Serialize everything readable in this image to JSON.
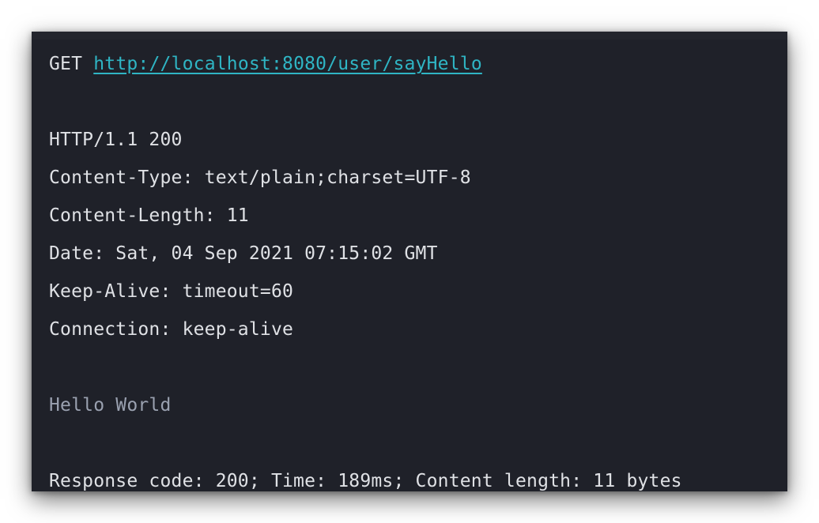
{
  "request": {
    "method": "GET",
    "url": "http://localhost:8080/user/sayHello"
  },
  "response": {
    "status_line": "HTTP/1.1 200",
    "headers": [
      "Content-Type: text/plain;charset=UTF-8",
      "Content-Length: 11",
      "Date: Sat, 04 Sep 2021 07:15:02 GMT",
      "Keep-Alive: timeout=60",
      "Connection: keep-alive"
    ],
    "body": "Hello World",
    "summary": "Response code: 200; Time: 189ms; Content length: 11 bytes"
  },
  "colors": {
    "background": "#1f2129",
    "text": "#dfe1e5",
    "link": "#2fb5c4",
    "body_text": "#9aa1b0"
  }
}
